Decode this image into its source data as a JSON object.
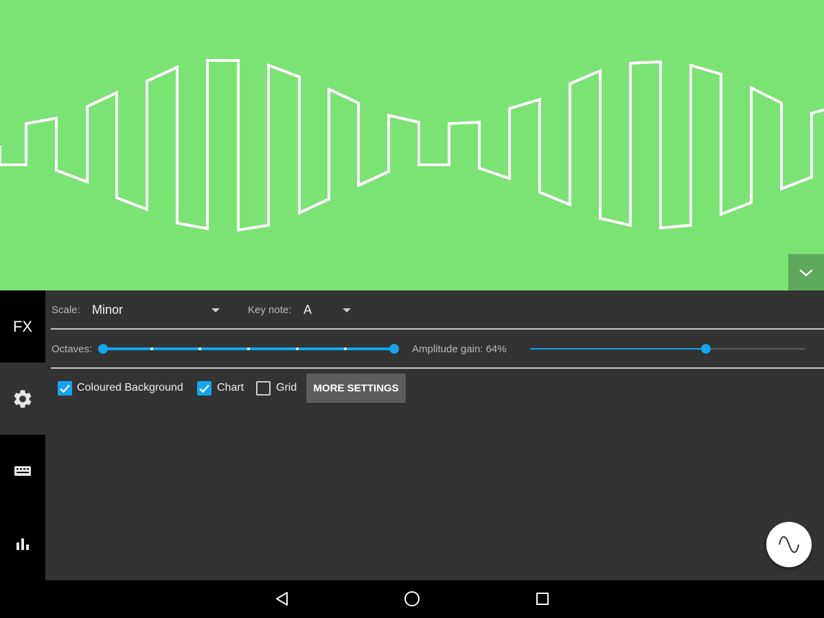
{
  "colors": {
    "wave_background": "#7be374",
    "wave_line": "#ffffff",
    "panel_background": "#333333",
    "accent": "#13a5f0",
    "sidebar_background": "#000000"
  },
  "sidebar": {
    "tabs": [
      {
        "id": "fx",
        "label": "FX",
        "icon": "fx-text",
        "active": false
      },
      {
        "id": "settings",
        "icon": "gear-icon",
        "active": true
      },
      {
        "id": "keyboard",
        "icon": "keyboard-icon",
        "active": false
      },
      {
        "id": "chart",
        "icon": "bar-chart-icon",
        "active": false
      }
    ]
  },
  "settings": {
    "scale": {
      "label": "Scale:",
      "value": "Minor"
    },
    "key_note": {
      "label": "Key note:",
      "value": "A"
    },
    "octaves": {
      "label": "Octaves:",
      "level": 1.0,
      "ticks": 7
    },
    "amplitude_gain": {
      "label": "Amplitude gain: 64%",
      "level_percent": 64
    },
    "checkboxes": [
      {
        "id": "coloured-background",
        "label": "Coloured Background",
        "checked": true
      },
      {
        "id": "chart",
        "label": "Chart",
        "checked": true
      },
      {
        "id": "grid",
        "label": "Grid",
        "checked": false
      }
    ],
    "more_settings_label": "MORE SETTINGS"
  },
  "fab": {
    "icon": "sine-wave-icon"
  },
  "collapse_button": {
    "icon": "chevron-down-icon"
  },
  "navbar": {
    "icons": [
      "back-icon",
      "home-icon",
      "recents-icon"
    ]
  }
}
